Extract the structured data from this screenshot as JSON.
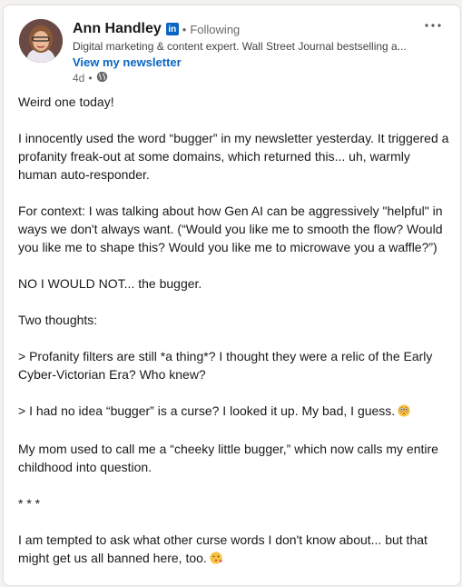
{
  "author": {
    "name": "Ann Handley",
    "badge": "in",
    "separator": "•",
    "follow_status": "Following",
    "headline": "Digital marketing & content expert. Wall Street Journal bestselling a...",
    "newsletter_link": "View my newsletter",
    "time_ago": "4d",
    "meta_separator": "•",
    "visibility_icon": "globe-icon"
  },
  "menu": {
    "icon": "more-options-icon"
  },
  "post": {
    "paragraphs": [
      "Weird one today!",
      "I innocently used the word “bugger” in my newsletter yesterday. It triggered a profanity freak-out at some domains, which returned this... uh, warmly human auto-responder.",
      "For context: I was talking about how Gen AI can be aggressively \"helpful\" in ways we don't always want. (“Would you like me to smooth the flow? Would you like me to shape this? Would you like me to microwave you a waffle?”)",
      "NO I WOULD NOT... the bugger.",
      "Two thoughts:",
      "> Profanity filters are still *a thing*? I thought they were a relic of the Early Cyber-Victorian Era? Who knew?",
      "> I had no idea “bugger” is a curse? I looked it up. My bad, I guess.",
      "My mom used to call me a “cheeky little bugger,” which now calls my entire childhood into question.",
      "* * *",
      "I am tempted to ask what other curse words I don't know about... but that might get us all banned here, too."
    ],
    "emoji_flushed": "flushed-face-emoji",
    "emoji_kiss": "face-blowing-kiss-emoji"
  },
  "colors": {
    "brand": "#0a66c2",
    "text": "#191919",
    "secondary": "#666666",
    "background": "#f4f2ee"
  }
}
